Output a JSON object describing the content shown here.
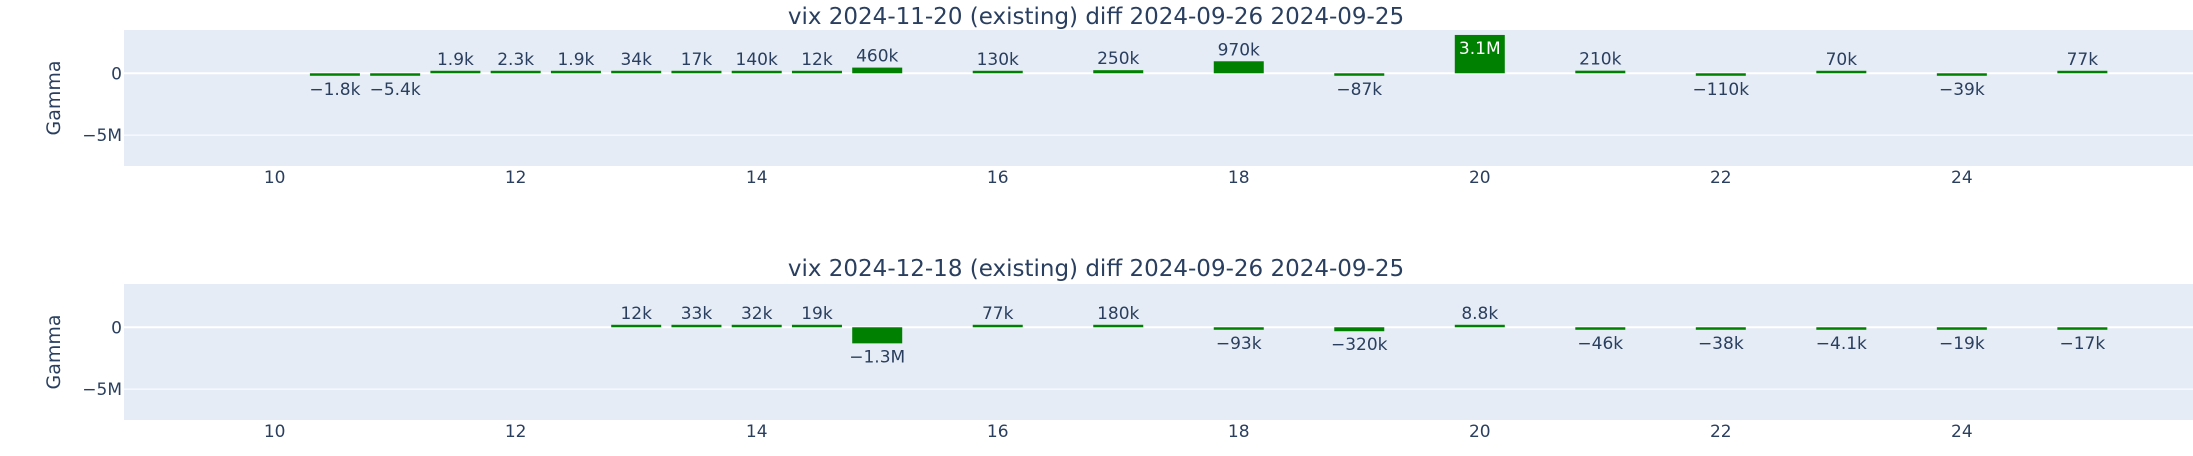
{
  "colors": {
    "plot_bg": "#E5ECF6",
    "bar": "#008000",
    "grid": "#ffffff",
    "text": "#2a3f5f"
  },
  "chart_data": [
    {
      "type": "bar",
      "title": "vix 2024-11-20 (existing) diff 2024-09-26 2024-09-25",
      "ylabel": "Gamma",
      "xlim": [
        8.75,
        26.25
      ],
      "ylim": [
        -7500000,
        3500000
      ],
      "yticks": [
        0,
        -5000000
      ],
      "ytick_labels": [
        "0",
        "−5M"
      ],
      "xticks": [
        10,
        12,
        14,
        16,
        18,
        20,
        22,
        24
      ],
      "xtick_labels": [
        "10",
        "12",
        "14",
        "16",
        "18",
        "20",
        "22",
        "24"
      ],
      "x": [
        10.5,
        11,
        11.5,
        12,
        12.5,
        13,
        13.5,
        14,
        14.5,
        15,
        16,
        17,
        18,
        19,
        20,
        21,
        22,
        23,
        24,
        25
      ],
      "values": [
        -1800,
        -5400,
        1900,
        2300,
        1900,
        34000,
        17000,
        140000,
        12000,
        460000,
        130000,
        250000,
        970000,
        -87000,
        3100000,
        210000,
        -110000,
        70000,
        -39000,
        77000
      ],
      "labels": [
        "−1.8k",
        "−5.4k",
        "1.9k",
        "2.3k",
        "1.9k",
        "34k",
        "17k",
        "140k",
        "12k",
        "460k",
        "130k",
        "250k",
        "970k",
        "−87k",
        "3.1M",
        "210k",
        "−110k",
        "70k",
        "−39k",
        "77k"
      ]
    },
    {
      "type": "bar",
      "title": "vix 2024-12-18 (existing) diff 2024-09-26 2024-09-25",
      "ylabel": "Gamma",
      "xlim": [
        8.75,
        26.25
      ],
      "ylim": [
        -7500000,
        3500000
      ],
      "yticks": [
        0,
        -5000000
      ],
      "ytick_labels": [
        "0",
        "−5M"
      ],
      "xticks": [
        10,
        12,
        14,
        16,
        18,
        20,
        22,
        24
      ],
      "xtick_labels": [
        "10",
        "12",
        "14",
        "16",
        "18",
        "20",
        "22",
        "24"
      ],
      "x": [
        13,
        13.5,
        14,
        14.5,
        15,
        16,
        17,
        18,
        19,
        20,
        21,
        22,
        23,
        24,
        25
      ],
      "values": [
        12000,
        33000,
        32000,
        19000,
        -1300000,
        77000,
        180000,
        -93000,
        -320000,
        8800,
        -46000,
        -38000,
        -4100,
        -19000,
        -17000
      ],
      "labels": [
        "12k",
        "33k",
        "32k",
        "19k",
        "−1.3M",
        "77k",
        "180k",
        "−93k",
        "−320k",
        "8.8k",
        "−46k",
        "−38k",
        "−4.1k",
        "−19k",
        "−17k"
      ]
    }
  ]
}
